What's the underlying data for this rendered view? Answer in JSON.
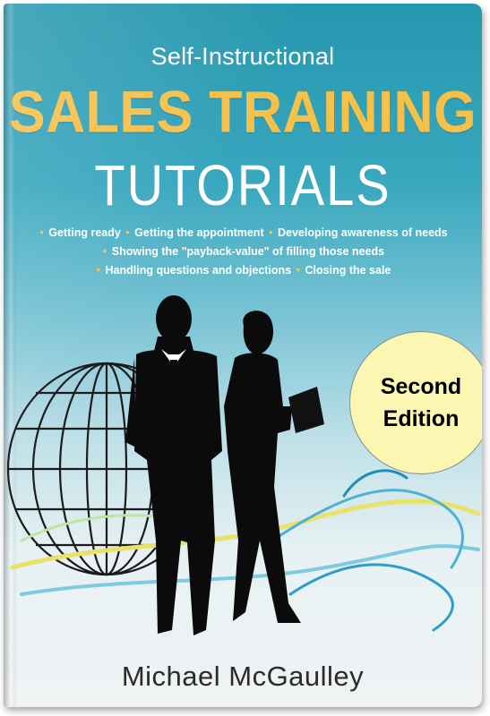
{
  "cover": {
    "subtitle": "Self-Instructional",
    "title_line1": "SALES TRAINING",
    "title_line2": "TUTORIALS",
    "bullets": [
      [
        "Getting ready",
        "Getting the appointment",
        "Developing awareness of needs"
      ],
      [
        "Showing the \"payback-value\" of filling those needs"
      ],
      [
        "Handling questions and objections",
        "Closing the sale"
      ]
    ],
    "bullet_symbol": "•",
    "badge": {
      "line1": "Second",
      "line2": "Edition"
    },
    "author": "Michael McGaulley",
    "illustration": "globe-and-business-people-silhouette",
    "colors": {
      "background_top": "#2597ae",
      "background_bottom": "#f1f3f4",
      "title_gold": "#f6c14b",
      "badge_fill": "#fbf6b2"
    }
  }
}
